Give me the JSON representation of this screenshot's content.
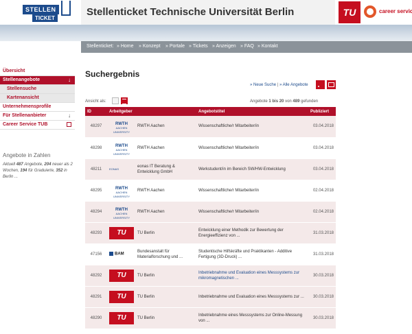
{
  "header": {
    "logo_top": "STELLEN",
    "logo_bottom": "TICKET",
    "site_title": "Stellenticket Technische Universität Berlin",
    "tu_logo": "TU",
    "career_logo": "career service"
  },
  "nav": {
    "prefix": "Stellenticket:",
    "items": [
      "» Home",
      "» Konzept",
      "» Portale",
      "» Tickets",
      "» Anzeigen",
      "» FAQ",
      "» Kontakt"
    ]
  },
  "sidebar": {
    "items": [
      {
        "label": "Übersicht"
      },
      {
        "label": "Stellenangebote"
      },
      {
        "label": "Stellensuche"
      },
      {
        "label": "Kartenansicht"
      },
      {
        "label": "Unternehmensprofile"
      },
      {
        "label": "Für Stellenanbieter"
      },
      {
        "label": "Career Service TUB"
      }
    ],
    "stats_title": "Angebote in Zahlen",
    "stats": {
      "aktuell": "Aktuell",
      "n1": "487",
      "t1": "Angebote,",
      "n2": "204",
      "t2": "neuer als 2 Wochen,",
      "n3": "194",
      "t3": "für Graduierte,",
      "n4": "352",
      "t4": "in Berlin ..."
    }
  },
  "main": {
    "title": "Suchergebnis",
    "link_new": "» Neue Suche",
    "sep": "|",
    "link_all": "» Alle Angebote",
    "view_label": "Ansicht als:",
    "count_prefix": "Angebote",
    "count_range": "1 bis 20",
    "count_of": "von",
    "count_total": "489",
    "count_suffix": "gefunden",
    "columns": [
      "ID",
      "Arbeitgeber",
      "Angebotstitel",
      "Publiziert"
    ],
    "rows": [
      {
        "id": "48297",
        "logo": "RWTH",
        "employer": "RWTH Aachen",
        "title": "Wissenschaftliche/r Mitarbeiter/in",
        "date": "03.04.2018"
      },
      {
        "id": "48298",
        "logo": "RWTH",
        "employer": "RWTH Aachen",
        "title": "Wissenschaftliche/r Mitarbeiter/in",
        "date": "03.04.2018"
      },
      {
        "id": "48211",
        "logo": "eonas",
        "employer": "eonas IT Beratung & Entwicklung GmbH",
        "title": "Werkstudent/in im Bereich SW/HW-Entwicklung",
        "date": "03.04.2018"
      },
      {
        "id": "48295",
        "logo": "RWTH",
        "employer": "RWTH Aachen",
        "title": "Wissenschaftliche/r Mitarbeiter/in",
        "date": "02.04.2018"
      },
      {
        "id": "48294",
        "logo": "RWTH",
        "employer": "RWTH Aachen",
        "title": "Wissenschaftliche/r Mitarbeiter/in",
        "date": "02.04.2018"
      },
      {
        "id": "48293",
        "logo": "TU",
        "employer": "TU Berlin",
        "title": "Entwicklung einer Methodik zur Bewertung der Energieeffizienz von ...",
        "date": "31.03.2018"
      },
      {
        "id": "47156",
        "logo": "BAM",
        "employer": "Bundesanstalt für Materialforschung und ...",
        "title": "Studentische Hilfskräfte und Praktikanten - Additive Fertigung (3D-Druck) ...",
        "date": "31.03.2018"
      },
      {
        "id": "48292",
        "logo": "TU",
        "employer": "TU Berlin",
        "title": "Inbetriebnahme und Evaluation eines Messsystems zur mikromagnetischen ...",
        "date": "30.03.2018"
      },
      {
        "id": "48291",
        "logo": "TU",
        "employer": "TU Berlin",
        "title": "Inbetriebnahme und Evaluation eines Messsystems zur ...",
        "date": "30.03.2018"
      },
      {
        "id": "48290",
        "logo": "TU",
        "employer": "TU Berlin",
        "title": "Inbetriebnahme eines Messsystems zur Online-Messung von ...",
        "date": "30.03.2018"
      }
    ],
    "logo_text": {
      "rwth_main": "RWTH",
      "rwth_sub": "AACHEN UNIVERSITY",
      "eonas": "EONAS",
      "tu": "TU",
      "bam": "BAM"
    }
  },
  "colors": {
    "accent": "#b0102a",
    "link": "#1c4b8c",
    "nav": "#8b939a",
    "row_alt": "#f4e9e9"
  }
}
